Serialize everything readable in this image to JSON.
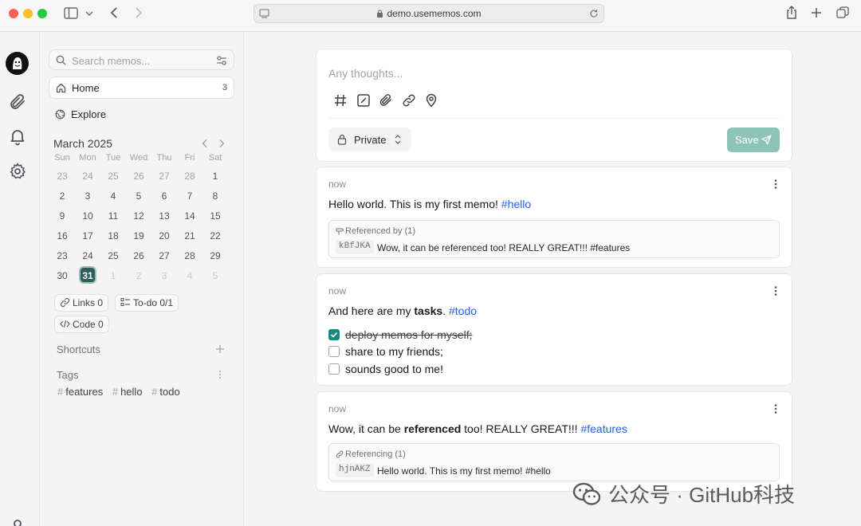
{
  "browser": {
    "url": "demo.usememos.com",
    "colors": {
      "close": "#ff5f57",
      "minimize": "#febc2e",
      "zoom": "#28c840"
    }
  },
  "sidebar": {
    "search_placeholder": "Search memos...",
    "nav": [
      {
        "label": "Home",
        "count": "3",
        "icon": "home-icon",
        "active": true
      },
      {
        "label": "Explore",
        "icon": "globe-icon"
      }
    ],
    "calendar": {
      "title": "March 2025",
      "weekdays": [
        "Sun",
        "Mon",
        "Tue",
        "Wed",
        "Thu",
        "Fri",
        "Sat"
      ],
      "weeks": [
        [
          "23",
          "24",
          "25",
          "26",
          "27",
          "28",
          "1"
        ],
        [
          "2",
          "3",
          "4",
          "5",
          "6",
          "7",
          "8"
        ],
        [
          "9",
          "10",
          "11",
          "12",
          "13",
          "14",
          "15"
        ],
        [
          "16",
          "17",
          "18",
          "19",
          "20",
          "21",
          "22"
        ],
        [
          "23",
          "24",
          "25",
          "26",
          "27",
          "28",
          "29"
        ],
        [
          "30",
          "31",
          "1",
          "2",
          "3",
          "4",
          "5"
        ]
      ],
      "selected_day": "31"
    },
    "stats": {
      "links": "Links 0",
      "todo": "To-do 0/1",
      "code": "Code 0"
    },
    "shortcuts_title": "Shortcuts",
    "tags_title": "Tags",
    "tags": [
      "features",
      "hello",
      "todo"
    ]
  },
  "editor": {
    "placeholder": "Any thoughts...",
    "tools": [
      "hash-icon",
      "checkbox-icon",
      "paperclip-icon",
      "link-icon",
      "map-pin-icon"
    ],
    "visibility": "Private",
    "save_label": "Save",
    "save_color": "#8cc5b8"
  },
  "memos": [
    {
      "time": "now",
      "text": "Hello world. This is my first memo! ",
      "tag": "#hello",
      "ref_header": "Referenced by (1)",
      "ref_id": "kBfJKA",
      "ref_text": "Wow, it can be referenced too! REALLY GREAT!!! #features"
    },
    {
      "time": "now",
      "text_before": "And here are my ",
      "text_bold": "tasks",
      "text_after": ". ",
      "tag": "#todo",
      "tasks": [
        {
          "text": "deploy memos for myself;",
          "done": true
        },
        {
          "text": "share to my friends;",
          "done": false
        },
        {
          "text": "sounds good to me!",
          "done": false
        }
      ]
    },
    {
      "time": "now",
      "text_before": "Wow, it can be ",
      "text_bold": "referenced",
      "text_after": " too! REALLY GREAT!!! ",
      "tag": "#features",
      "ref_header": "Referencing (1)",
      "ref_id": "hjnAKZ",
      "ref_text": "Hello world. This is my first memo! #hello"
    }
  ],
  "watermark": "公众号 · GitHub科技",
  "accent": "#168a80",
  "link_color": "#2563eb"
}
